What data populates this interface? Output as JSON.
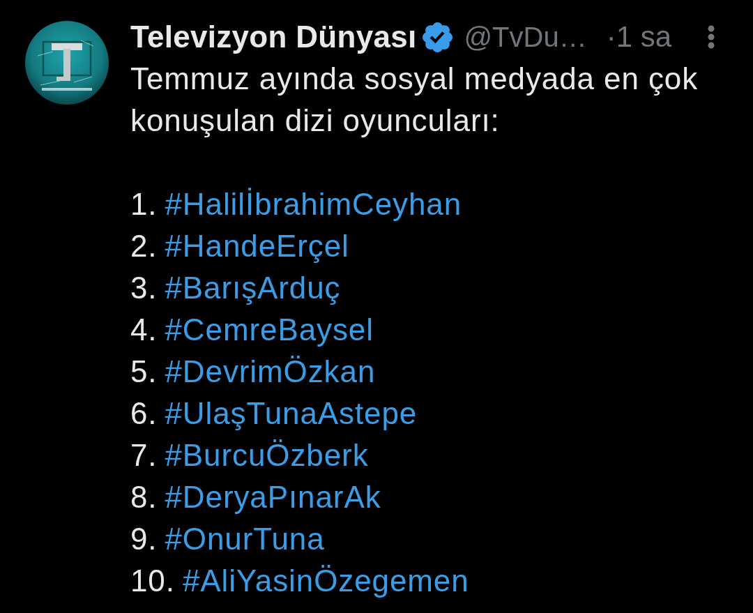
{
  "post": {
    "author": {
      "name": "Televizyon Dünyası",
      "verified": true,
      "handle": "@TvDu…",
      "time": "·1 sa"
    },
    "intro": "Temmuz ayında sosyal medyada en çok konuşulan dizi oyuncuları:",
    "list": [
      {
        "number": "1.",
        "hashtag": "#HalilİbrahimCeyhan"
      },
      {
        "number": "2.",
        "hashtag": "#HandeErçel"
      },
      {
        "number": "3.",
        "hashtag": "#BarışArduç"
      },
      {
        "number": "4.",
        "hashtag": "#CemreBaysel"
      },
      {
        "number": "5.",
        "hashtag": "#DevrimÖzkan"
      },
      {
        "number": "6.",
        "hashtag": "#UlaşTunaAstepe"
      },
      {
        "number": "7.",
        "hashtag": "#BurcuÖzberk"
      },
      {
        "number": "8.",
        "hashtag": "#DeryaPınarAk"
      },
      {
        "number": "9.",
        "hashtag": "#OnurTuna"
      },
      {
        "number": "10.",
        "hashtag": "#AliYasinÖzegemen"
      }
    ]
  }
}
